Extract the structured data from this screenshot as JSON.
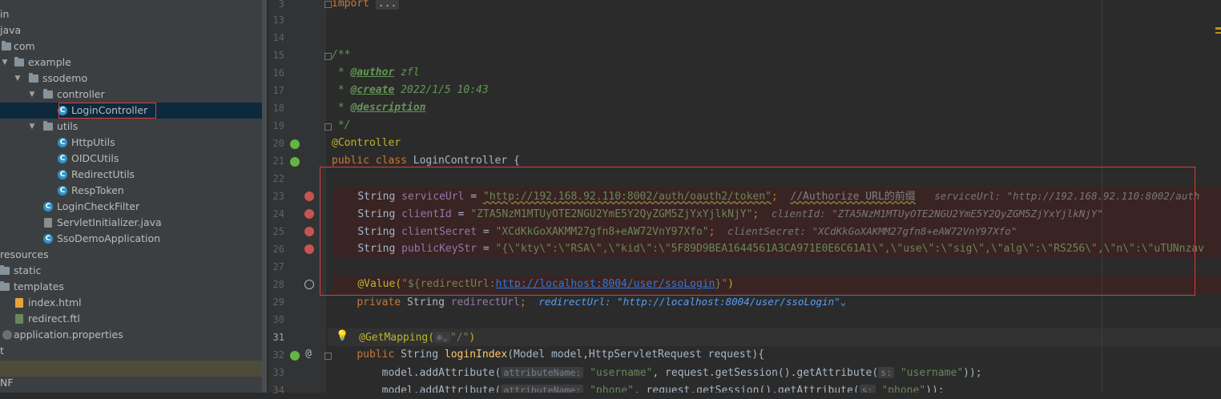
{
  "project_tree": {
    "items": [
      {
        "label": "in",
        "icon": "none"
      },
      {
        "label": "java",
        "icon": "none"
      },
      {
        "label": "com",
        "icon": "folder-icon"
      },
      {
        "label": "example",
        "icon": "folder-icon"
      },
      {
        "label": "ssodemo",
        "icon": "folder-icon"
      },
      {
        "label": "controller",
        "icon": "folder-icon"
      },
      {
        "label": "LoginController",
        "icon": "class-icon"
      },
      {
        "label": "utils",
        "icon": "folder-icon"
      },
      {
        "label": "HttpUtils",
        "icon": "class-icon"
      },
      {
        "label": "OIDCUtils",
        "icon": "class-icon"
      },
      {
        "label": "RedirectUtils",
        "icon": "class-icon"
      },
      {
        "label": "RespToken",
        "icon": "class-icon"
      },
      {
        "label": "LoginCheckFilter",
        "icon": "class-icon"
      },
      {
        "label": "ServletInitializer.java",
        "icon": "java-file-icon"
      },
      {
        "label": "SsoDemoApplication",
        "icon": "class-icon"
      },
      {
        "label": "resources",
        "icon": "folder-icon"
      },
      {
        "label": "static",
        "icon": "folder-icon"
      },
      {
        "label": "templates",
        "icon": "folder-icon"
      },
      {
        "label": "index.html",
        "icon": "html-file-icon"
      },
      {
        "label": "redirect.ftl",
        "icon": "ftl-file-icon"
      },
      {
        "label": "application.properties",
        "icon": "properties-file-icon"
      },
      {
        "label": "t",
        "icon": "none"
      },
      {
        "label": "",
        "icon": "none"
      },
      {
        "label": "NF",
        "icon": "none"
      }
    ]
  },
  "gutter": {
    "line_numbers": [
      "3",
      "13",
      "14",
      "15",
      "16",
      "17",
      "18",
      "19",
      "20",
      "21",
      "22",
      "23",
      "24",
      "25",
      "26",
      "27",
      "28",
      "29",
      "30",
      "31",
      "32",
      "33",
      "34"
    ]
  },
  "code": {
    "l3_kw": "import",
    "l3_fold": "...",
    "l15": "/**",
    "l16_star": " * ",
    "l16_tag": "@author",
    "l16_text": " zfl",
    "l17_star": " * ",
    "l17_tag": "@create",
    "l17_text": " 2022/1/5 10:43",
    "l18_star": " * ",
    "l18_tag": "@description",
    "l19": " */",
    "l20": "@Controller",
    "l21_kw": "public class ",
    "l21_name": "LoginController {",
    "l23_type": "String ",
    "l23_field": "serviceUrl",
    "l23_eq": " = ",
    "l23_str": "\"http://192.168.92.110:8002/auth/oauth2/token\"",
    "l23_semi": ";  ",
    "l23_cmt": "//Authorize URL的前缀",
    "l23_hint": "serviceUrl: \"http://192.168.92.110:8002/auth",
    "l24_type": "String ",
    "l24_field": "clientId",
    "l24_eq": " = ",
    "l24_str": "\"ZTA5NzM1MTUyOTE2NGU2YmE5Y2QyZGM5ZjYxYjlkNjY\"",
    "l24_semi": ";  ",
    "l24_hint": "clientId: \"ZTA5NzM1MTUyOTE2NGU2YmE5Y2QyZGM5ZjYxYjlkNjY\"",
    "l25_type": "String ",
    "l25_field": "clientSecret",
    "l25_eq": " = ",
    "l25_str": "\"XCdKkGoXAKMM27gfn8+eAW72VnY97Xfo\"",
    "l25_semi": ";  ",
    "l25_hint": "clientSecret: \"XCdKkGoXAKMM27gfn8+eAW72VnY97Xfo\"",
    "l26_type": "String ",
    "l26_field": "publicKeyStr",
    "l26_eq": " = ",
    "l26_str": "\"{\\\"kty\\\":\\\"RSA\\\",\\\"kid\\\":\\\"5F89D9BEA1644561A3CA971E0E6C61A1\\\",\\\"use\\\":\\\"sig\\\",\\\"alg\\\":\\\"RS256\\\",\\\"n\\\":\\\"uTUNnzav",
    "l28_ann": "@Value(",
    "l28_str1": "\"${redirectUrl:",
    "l28_link": "http://localhost:8004/user/ssoLogin",
    "l28_str2": "}\"",
    "l28_close": ")",
    "l29_kw": "private ",
    "l29_type": "String ",
    "l29_field": "redirectUrl",
    "l29_semi": ";  ",
    "l29_hint": "redirectUrl: \"http://localhost:8004/user/ssoLogin\"",
    "l29_chev": "⌄",
    "l31_ann": "@GetMapping(",
    "l31_globe": "⊕⌄",
    "l31_str": "\"/\"",
    "l31_close": ")",
    "l32_kw": "public ",
    "l32_type": "String ",
    "l32_mth": "loginIndex",
    "l32_rest": "(Model model,HttpServletRequest request){",
    "l33_pre": "model.addAttribute(",
    "l33_inlay1": "attributeName:",
    "l33_str1": "\"username\"",
    "l33_mid": ", request.getSession().getAttribute(",
    "l33_inlay2": "s:",
    "l33_str2": "\"username\"",
    "l33_end": "));",
    "l34_pre": "model.addAttribute(",
    "l34_inlay1": "attributeName:",
    "l34_str1": "\"phone\"",
    "l34_mid": ", request.getSession().getAttribute(",
    "l34_inlay2": "s:",
    "l34_str2": "\"phone\"",
    "l34_end": "));"
  }
}
